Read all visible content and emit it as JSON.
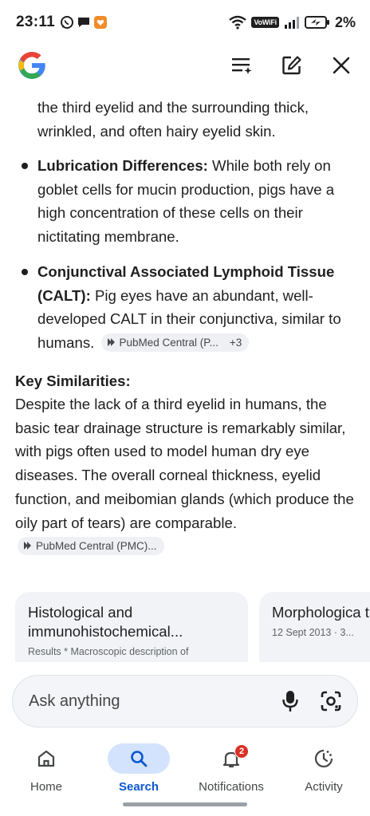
{
  "status_bar": {
    "time": "23:11",
    "network_label": "VoWiFi",
    "battery_percent": "2%"
  },
  "header": {
    "logo": "google-g-logo",
    "actions": [
      "filter-sparkle-icon",
      "edit-icon",
      "close-icon"
    ]
  },
  "content": {
    "partial_text": "the third eyelid and the surrounding thick, wrinkled, and often hairy eyelid skin.",
    "bullets": [
      {
        "title": "Lubrication Differences:",
        "text": " While both rely on goblet cells for mucin production, pigs have a high concentration of these cells on their nictitating membrane."
      },
      {
        "title": "Conjunctival Associated Lymphoid Tissue (CALT):",
        "text": " Pig eyes have an abundant, well-developed CALT in their conjunctiva, similar to humans.",
        "source_chip": "PubMed Central (P...",
        "source_more": "+3"
      }
    ],
    "section_title": "Key Similarities:",
    "section_text": "Despite the lack of a third eyelid in humans, the basic tear drainage structure is remarkably similar, with pigs often used to model human dry eye diseases. The overall corneal thickness, eyelid function, and meibomian glands (which produce the oily part of tears) are comparable.",
    "section_chip": "PubMed Central (PMC)...",
    "cards": [
      {
        "title": "Histological and immunohistochemical...",
        "subtitle": "Results * Macroscopic description of"
      },
      {
        "title": "Morphologica the Porcine La",
        "subtitle": "12 Sept 2013 · 3..."
      }
    ]
  },
  "ask_bar": {
    "placeholder": "Ask anything"
  },
  "bottom_nav": {
    "items": [
      {
        "label": "Home",
        "icon": "home-icon"
      },
      {
        "label": "Search",
        "icon": "search-icon",
        "active": true
      },
      {
        "label": "Notifications",
        "icon": "bell-icon",
        "badge": "2"
      },
      {
        "label": "Activity",
        "icon": "activity-icon"
      }
    ]
  },
  "colors": {
    "accent": "#0b57d0",
    "active_pill": "#d3e3fd",
    "badge": "#d93025"
  }
}
